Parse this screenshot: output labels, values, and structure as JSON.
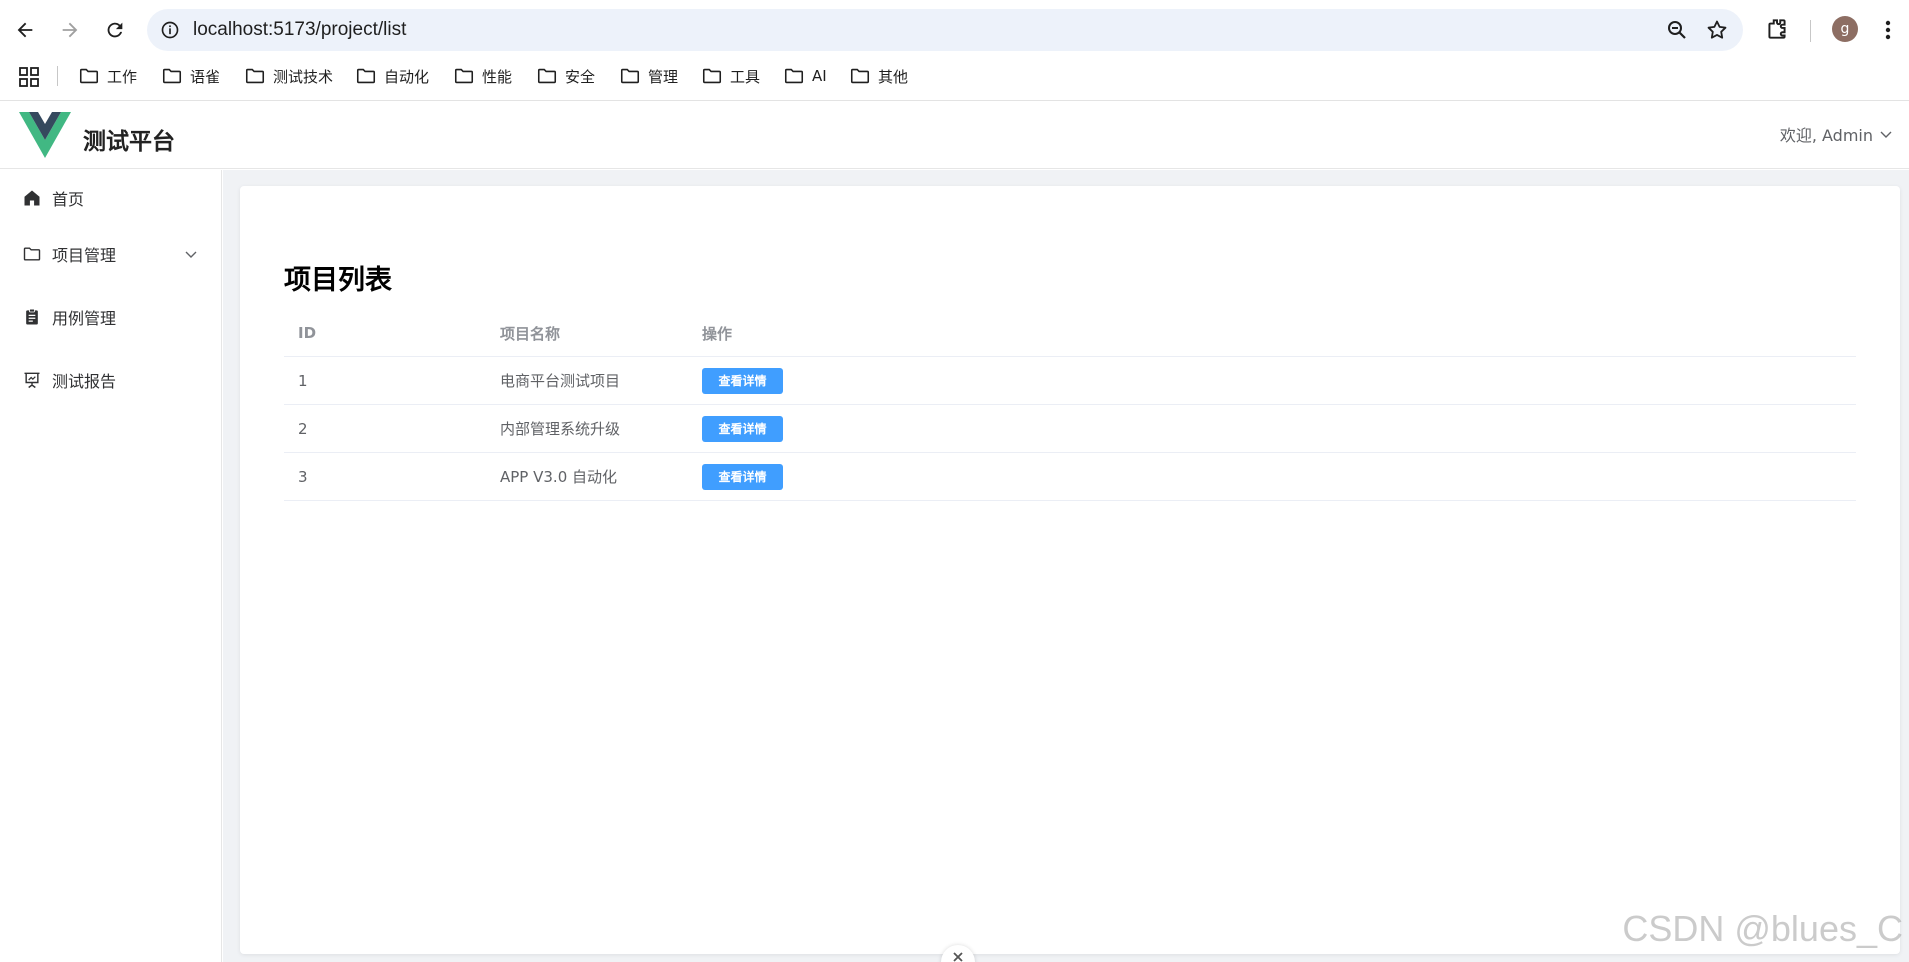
{
  "browser": {
    "url": "localhost:5173/project/list",
    "profile_initial": "g",
    "bookmarks": [
      {
        "label": "工作"
      },
      {
        "label": "语雀"
      },
      {
        "label": "测试技术"
      },
      {
        "label": "自动化"
      },
      {
        "label": "性能"
      },
      {
        "label": "安全"
      },
      {
        "label": "管理"
      },
      {
        "label": "工具"
      },
      {
        "label": "AI"
      },
      {
        "label": "其他"
      }
    ]
  },
  "header": {
    "app_title": "测试平台",
    "user_greeting": "欢迎, Admin",
    "logo_colors": {
      "outer": "#41b883",
      "inner": "#35495e"
    }
  },
  "sidebar": {
    "items": [
      {
        "label": "首页",
        "icon": "home-icon"
      },
      {
        "label": "项目管理",
        "icon": "folder-icon",
        "expandable": true
      },
      {
        "label": "用例管理",
        "icon": "clipboard-icon"
      },
      {
        "label": "测试报告",
        "icon": "presentation-icon"
      }
    ]
  },
  "main": {
    "page_title": "项目列表",
    "table": {
      "columns": [
        "ID",
        "项目名称",
        "操作"
      ],
      "rows": [
        {
          "id": "1",
          "name": "电商平台测试项目",
          "action": "查看详情"
        },
        {
          "id": "2",
          "name": "内部管理系统升级",
          "action": "查看详情"
        },
        {
          "id": "3",
          "name": "APP V3.0 自动化",
          "action": "查看详情"
        }
      ]
    }
  },
  "watermark": "CSDN @blues_C",
  "colors": {
    "primary_button": "#409eff",
    "main_background": "#f0f2f5",
    "omnibox": "#edf2fa"
  }
}
